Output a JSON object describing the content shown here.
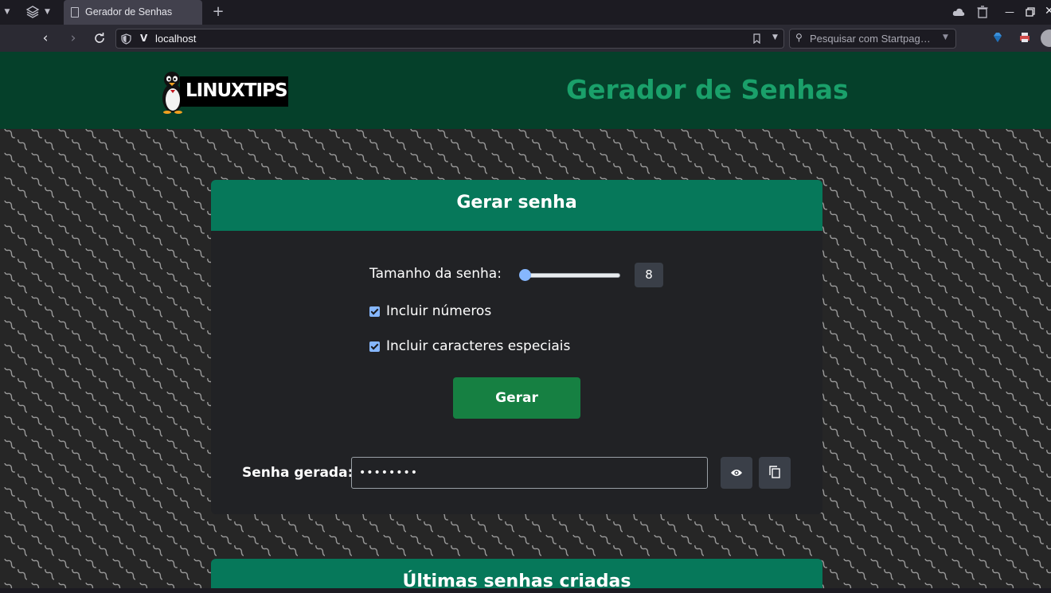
{
  "browser": {
    "tab_title": "Gerador de Senhas",
    "url": "localhost",
    "search_placeholder": "Pesquisar com Startpag…"
  },
  "header": {
    "logo_text": "LINUXTIPS",
    "title": "Gerador de Senhas"
  },
  "generator": {
    "title": "Gerar senha",
    "length_label": "Tamanho da senha:",
    "length_value": "8",
    "slider_fraction": 0.0,
    "include_numbers_label": "Incluir números",
    "include_numbers_checked": true,
    "include_special_label": "Incluir caracteres especiais",
    "include_special_checked": true,
    "generate_label": "Gerar",
    "output_label": "Senha gerada:",
    "output_value": "••••••••"
  },
  "history": {
    "title": "Últimas senhas criadas"
  },
  "colors": {
    "header_bg": "#05402a",
    "accent_title": "#1aa06a",
    "card_header": "#06785a",
    "button_green": "#168042"
  }
}
